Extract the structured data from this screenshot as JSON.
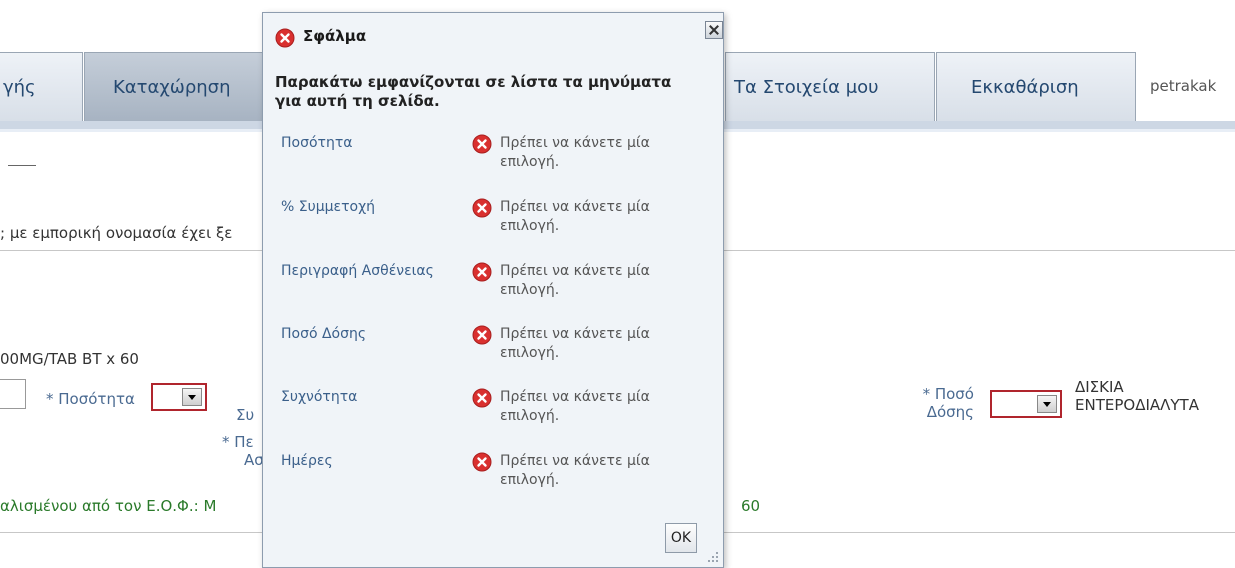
{
  "tabs": [
    {
      "label": "γής",
      "active": false
    },
    {
      "label": "Καταχώρηση",
      "active": true
    },
    {
      "label": "Τα Στοιχεία μου",
      "active": false
    },
    {
      "label": "Εκκαθάριση",
      "active": false
    }
  ],
  "user": "petrakak",
  "page": {
    "trade_name_text": "; με εμπορική ονομασία έχει ξε",
    "product_text": "00MG/TAB BT x 60",
    "quantity_label": "* Ποσότητα",
    "partial_sum_label": "Συ",
    "partial_desc_label": "* Πε",
    "partial_desc_label2": "Ασ",
    "dose_label_line1": "* Ποσό",
    "dose_label_line2": "Δόσης",
    "dosage_form_line1": "ΔΙΣΚΙΑ",
    "dosage_form_line2": "ΕΝΤΕΡΟΔΙΑΛΥΤΑ",
    "approved_text": "αλισμένου από τον Ε.Ο.Φ.: Μ",
    "approved_tail": "60"
  },
  "dialog": {
    "title": "Σφάλμα",
    "intro": "Παρακάτω εμφανίζονται σε λίστα τα μηνύματα για αυτή τη σελίδα.",
    "errors": [
      {
        "field": "Ποσότητα",
        "message": "Πρέπει να κάνετε μία επιλογή."
      },
      {
        "field": "% Συμμετοχή",
        "message": "Πρέπει να κάνετε μία επιλογή."
      },
      {
        "field": "Περιγραφή Ασθένειας",
        "message": "Πρέπει να κάνετε μία επιλογή."
      },
      {
        "field": "Ποσό Δόσης",
        "message": "Πρέπει να κάνετε μία επιλογή."
      },
      {
        "field": "Συχνότητα",
        "message": "Πρέπει να κάνετε μία επιλογή."
      },
      {
        "field": "Ημέρες",
        "message": "Πρέπει να κάνετε μία επιλογή."
      }
    ],
    "ok_label": "OK"
  },
  "colors": {
    "error_red": "#d9302f",
    "link_blue": "#3a5f8a",
    "approved_green": "#2a7a2a",
    "combo_border": "#b0252d"
  },
  "icons": {
    "error": "error-circle-x-icon",
    "close": "close-icon"
  }
}
